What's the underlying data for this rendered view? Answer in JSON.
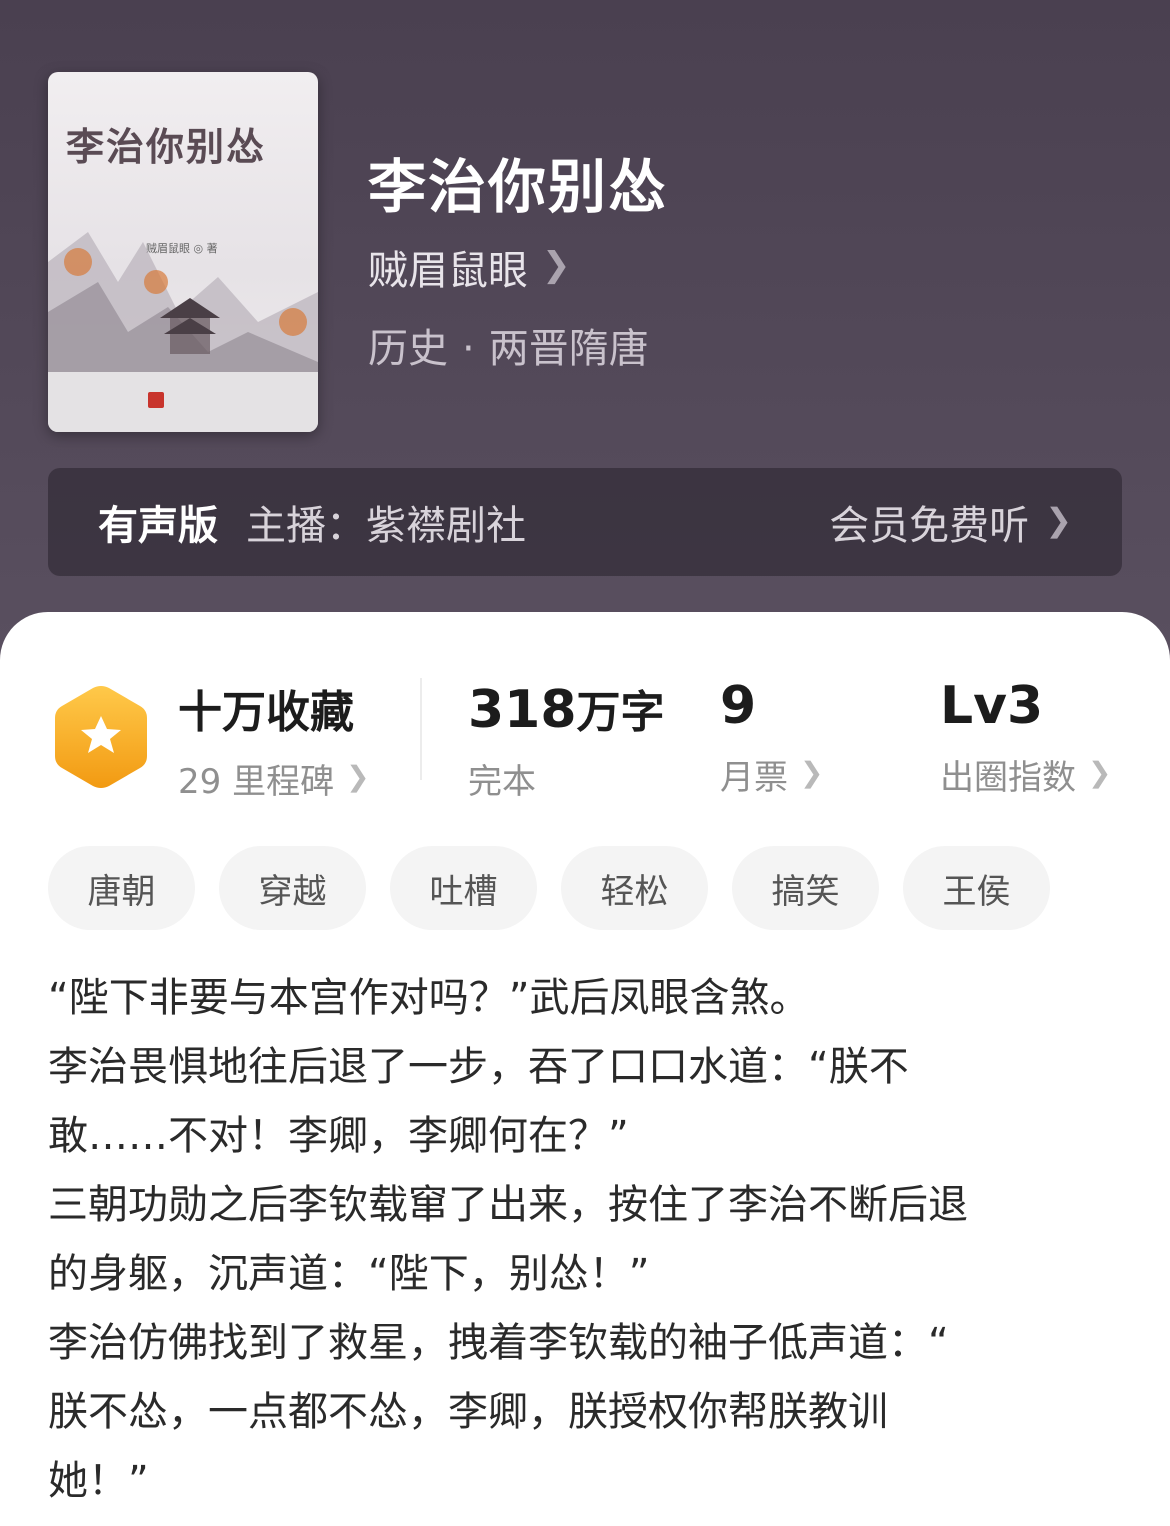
{
  "book": {
    "title": "李治你别怂",
    "author": "贼眉鼠眼",
    "category": "历史",
    "subcategory": "两晋隋唐",
    "separator": "·"
  },
  "cover": {
    "title": "李治你别怂",
    "author_line": "贼眉鼠眼 ◎ 著"
  },
  "audio": {
    "tag": "有声版",
    "host": "主播：紫襟剧社",
    "cta": "会员免费听"
  },
  "stats": {
    "favorites": {
      "value": "十万收藏",
      "sub": "29 里程碑"
    },
    "words": {
      "number": "318",
      "unit": "万字",
      "sub": "完本"
    },
    "monthly_tickets": {
      "value": "9",
      "sub": "月票"
    },
    "influence": {
      "value": "Lv3",
      "sub": "出圈指数"
    }
  },
  "tags": [
    "唐朝",
    "穿越",
    "吐槽",
    "轻松",
    "搞笑",
    "王侯"
  ],
  "synopsis_lines": [
    "“陛下非要与本宫作对吗？”武后凤眼含煞。",
    "李治畏惧地往后退了一步，吞了口口水道：“朕不",
    "敢……不对！李卿，李卿何在？”",
    "三朝功勋之后李钦载窜了出来，按住了李治不断后退",
    "的身躯，沉声道：“陛下，别怂！”",
    "李治仿佛找到了救星，拽着李钦载的袖子低声道：“",
    "朕不怂，一点都不怂，李卿，朕授权你帮朕教训",
    "她！”"
  ],
  "colors": {
    "header_bg": "#524858",
    "card_bg": "#ffffff",
    "badge_gold": "#f5a623",
    "tag_bg": "#f4f4f4"
  },
  "icons": {
    "badge": "star-hexagon-icon",
    "chevron": "chevron-right-icon"
  }
}
